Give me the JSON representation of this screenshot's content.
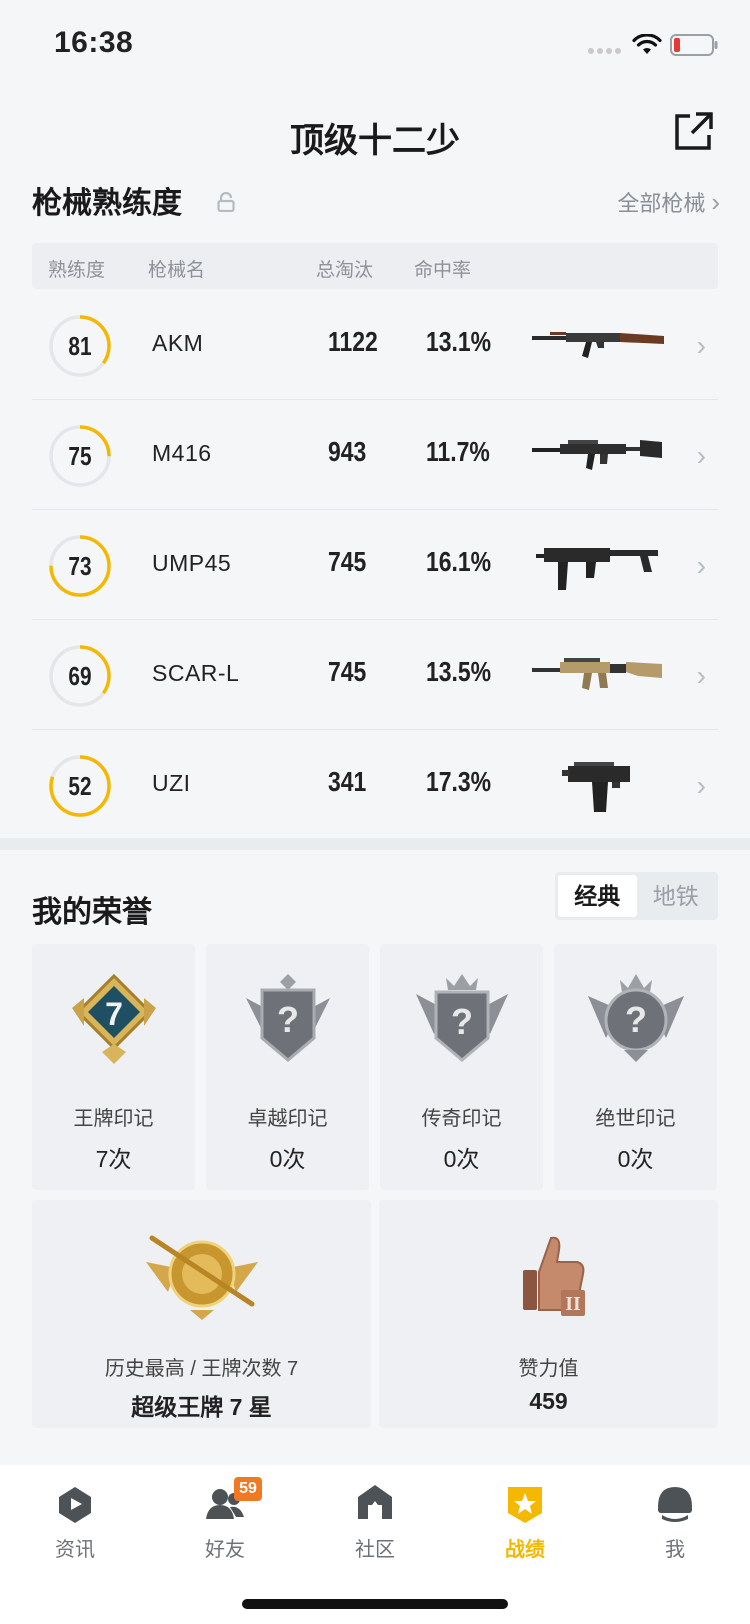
{
  "status_bar": {
    "time": "16:38"
  },
  "header": {
    "title": "顶级十二少"
  },
  "weapons": {
    "section_title": "枪械熟练度",
    "all_link": "全部枪械",
    "columns": [
      "熟练度",
      "枪械名",
      "总淘汰",
      "命中率"
    ],
    "rows": [
      {
        "proficiency": "81",
        "progress": 0.35,
        "name": "AKM",
        "kills": "1122",
        "accuracy": "13.1%",
        "gun_icon": "akm-rifle"
      },
      {
        "proficiency": "75",
        "progress": 0.25,
        "name": "M416",
        "kills": "943",
        "accuracy": "11.7%",
        "gun_icon": "m416-rifle"
      },
      {
        "proficiency": "73",
        "progress": 0.75,
        "name": "UMP45",
        "kills": "745",
        "accuracy": "16.1%",
        "gun_icon": "ump45-smg"
      },
      {
        "proficiency": "69",
        "progress": 0.35,
        "name": "SCAR-L",
        "kills": "745",
        "accuracy": "13.5%",
        "gun_icon": "scar-l-rifle"
      },
      {
        "proficiency": "52",
        "progress": 0.8,
        "name": "UZI",
        "kills": "341",
        "accuracy": "17.3%",
        "gun_icon": "uzi-smg"
      }
    ]
  },
  "honors": {
    "section_title": "我的荣誉",
    "mode_tabs": [
      "经典",
      "地铁"
    ],
    "badges": [
      {
        "label": "王牌印记",
        "count": "7次",
        "badge_number": "7"
      },
      {
        "label": "卓越印记",
        "count": "0次"
      },
      {
        "label": "传奇印记",
        "count": "0次"
      },
      {
        "label": "绝世印记",
        "count": "0次"
      }
    ],
    "highest": {
      "label": "历史最高 / 王牌次数 7",
      "value": "超级王牌 7 星"
    },
    "likes": {
      "label": "赞力值",
      "value": "459"
    }
  },
  "tab_bar": {
    "tabs": [
      {
        "label": "资讯",
        "icon": "news-icon"
      },
      {
        "label": "好友",
        "icon": "friends-icon",
        "badge": "59"
      },
      {
        "label": "社区",
        "icon": "community-icon"
      },
      {
        "label": "战绩",
        "icon": "stats-icon",
        "active": true
      },
      {
        "label": "我",
        "icon": "profile-icon"
      }
    ]
  },
  "colors": {
    "accent": "#f5b800",
    "ring_track": "#e4e6ea",
    "badge": "#f07a24"
  }
}
